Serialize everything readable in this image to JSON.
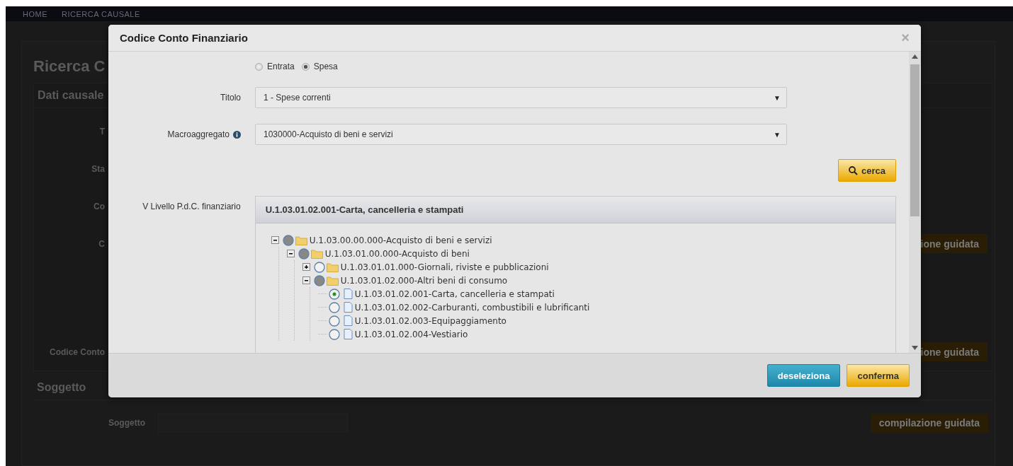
{
  "breadcrumb": [
    "HOME",
    "RICERCA CAUSALE"
  ],
  "page": {
    "title": "Ricerca C",
    "section": "Dati causale",
    "rows": [
      {
        "label": "T"
      },
      {
        "label": "Sta"
      },
      {
        "label": "Co"
      },
      {
        "label": "C",
        "button": "ione guidata"
      },
      {
        "label": "Codice Conto",
        "button": "ione guidata"
      }
    ],
    "subject_section": "Soggetto",
    "subject_label": "Soggetto",
    "subject_button": "compilazione guidata"
  },
  "modal": {
    "title": "Codice Conto Finanziario",
    "close": "×",
    "type_options": [
      {
        "label": "Entrata",
        "selected": false
      },
      {
        "label": "Spesa",
        "selected": true
      }
    ],
    "titolo": {
      "label": "Titolo",
      "value": "1 - Spese correnti",
      "caret": "▼"
    },
    "macroaggregato": {
      "label": "Macroaggregato",
      "value": "1030000-Acquisto di beni e servizi",
      "caret": "▼"
    },
    "search_button": "cerca",
    "tree_label": "V Livello P.d.C. finanziario",
    "tree_header": "U.1.03.01.02.001-Carta, cancelleria e stampati",
    "tree": [
      {
        "kind": "folder",
        "label": "U.1.03.00.00.000-Acquisto di beni e servizi",
        "expanded": true,
        "selected": false,
        "partial": true,
        "children": [
          {
            "kind": "folder",
            "label": "U.1.03.01.00.000-Acquisto di beni",
            "expanded": true,
            "selected": false,
            "partial": true,
            "children": [
              {
                "kind": "folder",
                "label": "U.1.03.01.01.000-Giornali, riviste e pubblicazioni",
                "expanded": false,
                "selected": false,
                "partial": false
              },
              {
                "kind": "folder",
                "label": "U.1.03.01.02.000-Altri beni di consumo",
                "expanded": true,
                "selected": false,
                "partial": true,
                "children": [
                  {
                    "kind": "leaf",
                    "label": "U.1.03.01.02.001-Carta, cancelleria e stampati",
                    "selected": true,
                    "partial": false
                  },
                  {
                    "kind": "leaf",
                    "label": "U.1.03.01.02.002-Carburanti, combustibili e lubrificanti",
                    "selected": false,
                    "partial": false
                  },
                  {
                    "kind": "leaf",
                    "label": "U.1.03.01.02.003-Equipaggiamento",
                    "selected": false,
                    "partial": false
                  },
                  {
                    "kind": "leaf",
                    "label": "U.1.03.01.02.004-Vestiario",
                    "selected": false,
                    "partial": false
                  }
                ]
              }
            ]
          }
        ]
      }
    ],
    "footer_buttons": [
      {
        "kind": "secondary",
        "label": "deseleziona"
      },
      {
        "kind": "primary",
        "label": "conferma"
      }
    ]
  }
}
